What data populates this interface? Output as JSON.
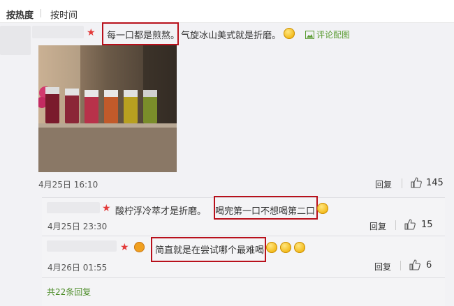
{
  "tabs": {
    "hot": "按热度",
    "time": "按时间"
  },
  "comment": {
    "text_highlight": "每一口都是煎熬。",
    "text_rest": "气旋冰山美式就是折磨。",
    "image_link": "评论配图",
    "date": "4月25日 16:10",
    "reply_label": "回复",
    "likes": "145"
  },
  "replies": [
    {
      "text_plain": "酸柠浮冷萃才是折磨。",
      "text_highlight": "喝完第一口不想喝第二口",
      "date": "4月25日 23:30",
      "reply_label": "回复",
      "likes": "15"
    },
    {
      "text_highlight": "简直就是在尝试哪个最难喝",
      "date": "4月26日 01:55",
      "reply_label": "回复",
      "likes": "6"
    }
  ],
  "more_replies": "共22条回复",
  "icons": [
    "star-badge-icon",
    "smile-emoji-icon",
    "image-icon",
    "thumb-up-icon",
    "gold-badge-icon"
  ],
  "colors": {
    "highlight_border": "#b8101b",
    "link_green": "#5a9b31",
    "star_red": "#e33a3a"
  }
}
